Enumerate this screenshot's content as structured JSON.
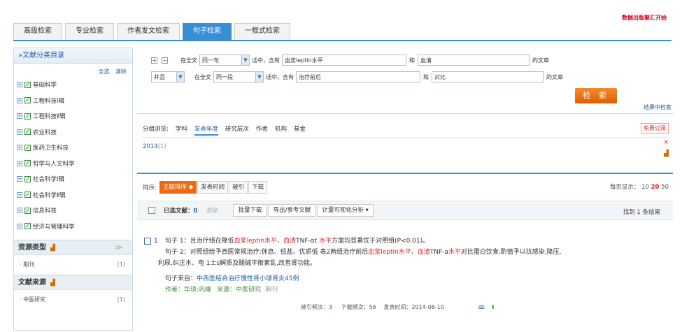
{
  "promo": "数据出版聚汇开始",
  "tabs": [
    "高级检索",
    "专业检索",
    "作者发文检索",
    "句子检索",
    "一框式检索"
  ],
  "sidebar": {
    "title": "文献分类目录",
    "select_all": "全选",
    "clear": "清除",
    "categories": [
      "基础科学",
      "工程科技Ⅰ辑",
      "工程科技Ⅱ辑",
      "农业科技",
      "医药卫生科技",
      "哲学与人文科学",
      "社会科学Ⅰ辑",
      "社会科学Ⅱ辑",
      "信息科技",
      "经济与管理科学"
    ],
    "resource_type": {
      "title": "资源类型",
      "item": "期刊",
      "count": "(1)"
    },
    "source": {
      "title": "文献来源",
      "item": "中医研究",
      "count": "(1)"
    }
  },
  "search": {
    "row1": {
      "scope_label": "在全文",
      "scope": "同一句",
      "mid": "话中，含有",
      "term1": "血浆leptin水平",
      "and": "和",
      "term2": "血清",
      "tail": "的文章"
    },
    "row2": {
      "logic": "并且",
      "scope_label": "在全文",
      "scope": "同一段",
      "mid": "话中，含有",
      "term1": "治疗前后",
      "and": "和",
      "term2": "对比",
      "tail": "的文章"
    },
    "button": "检 索",
    "in_results": "结果中检索"
  },
  "group": {
    "tabs": [
      "分组浏览:",
      "学科",
      "发表年度",
      "研究层次",
      "作者",
      "机构",
      "基金"
    ],
    "subscribe": "免费订阅",
    "year": "2014",
    "year_count": "(1)"
  },
  "results": {
    "sort_label": "排序:",
    "sort": [
      "主题排序 ◆",
      "发表时间",
      "被引",
      "下载"
    ],
    "per_page_label": "每页显示：",
    "per_page": [
      "10",
      "20",
      "50"
    ],
    "selected_label": "已选文献：",
    "selected_count": "0",
    "clear": "清除",
    "actions": [
      "批量下载",
      "导出/参考文献",
      "计量可视化分析 ▾"
    ],
    "found": "找到 1 条结果"
  },
  "item": {
    "num": "1",
    "s1_prefix": "句子 1：且治疗组在降低",
    "s1_r1": "血浆leptin水平",
    "s1_m1": "、",
    "s1_r2": "血清",
    "s1_m2": "TNF-αt ",
    "s1_r3": "水平",
    "s1_end": "方面均显著优于对照组(P<0.01)。",
    "s2_prefix": "句子 2：对照组给予西医常规治疗:休息、低盐、优质低 表2两组治疗前后",
    "s2_r1": "血浆leptin水平",
    "s2_m1": "、",
    "s2_r2": "血清",
    "s2_m2": "TNF-a",
    "s2_r3": "水平",
    "s2_end": "对比蛋白饮食,酌情予以抗感染,降压,",
    "s2_line2": "利尿,纠正水、电 1士s解质及酸碱平衡紊乱,改善肾功能。",
    "source_label": "句子来自：",
    "source_title": "中西医结合治疗慢性肾小球肾炎45例",
    "author_label": "作者：",
    "authors": "华琼;巩峰",
    "from_label": "来源：",
    "journal": "中医研究",
    "type": "期刊",
    "cited_label": "被引频次：",
    "cited": "3",
    "download_label": "下载频次：",
    "downloads": "56",
    "date_label": "发表时间：",
    "date": "2014-06-10"
  }
}
